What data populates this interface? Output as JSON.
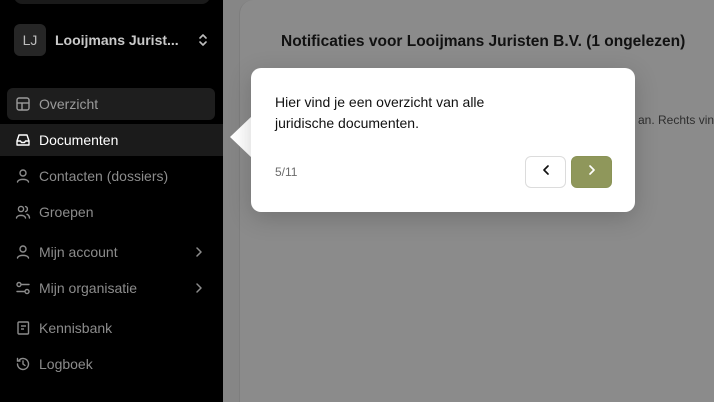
{
  "sidebar": {
    "org": {
      "initials": "LJ",
      "name": "Looijmans Jurist..."
    },
    "items": [
      {
        "label": "Overzicht",
        "icon": "grid-icon"
      },
      {
        "label": "Documenten",
        "icon": "inbox-icon"
      },
      {
        "label": "Contacten (dossiers)",
        "icon": "user-icon"
      },
      {
        "label": "Groepen",
        "icon": "users-icon"
      },
      {
        "label": "Mijn account",
        "icon": "user-icon"
      },
      {
        "label": "Mijn organisatie",
        "icon": "sliders-icon"
      },
      {
        "label": "Kennisbank",
        "icon": "book-icon"
      },
      {
        "label": "Logboek",
        "icon": "history-icon"
      }
    ]
  },
  "main": {
    "title": "Notificaties voor Looijmans Juristen B.V. (1 ongelezen)",
    "background_text": "an. Rechts vind"
  },
  "tour": {
    "text": "Hier vind je een overzicht van alle juridische documenten.",
    "step": "5/11"
  },
  "colors": {
    "accent": "#8f975b",
    "sidebar_bg": "#000000"
  }
}
